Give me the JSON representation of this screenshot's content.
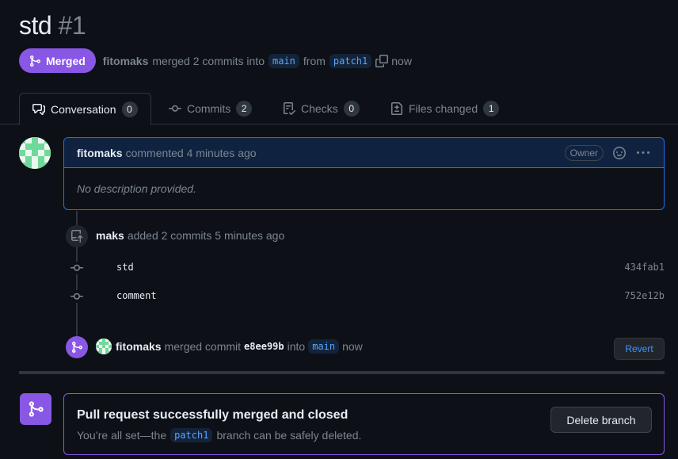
{
  "pr": {
    "title": "std",
    "number": "#1",
    "state_label": "Merged",
    "author": "fitomaks",
    "merge_summary": "merged 2 commits into",
    "base_branch": "main",
    "from_word": "from",
    "head_branch": "patch1",
    "time": "now"
  },
  "tabs": [
    {
      "label": "Conversation",
      "count": "0",
      "icon": "comment-discussion-icon"
    },
    {
      "label": "Commits",
      "count": "2",
      "icon": "git-commit-icon"
    },
    {
      "label": "Checks",
      "count": "0",
      "icon": "checklist-icon"
    },
    {
      "label": "Files changed",
      "count": "1",
      "icon": "file-diff-icon"
    }
  ],
  "comment": {
    "author": "fitomaks",
    "meta": "commented 4 minutes ago",
    "role_badge": "Owner",
    "body": "No description provided."
  },
  "commits_event": {
    "author": "maks",
    "text": "added 2 commits 5 minutes ago",
    "commits": [
      {
        "message": "std",
        "sha": "434fab1"
      },
      {
        "message": "comment",
        "sha": "752e12b"
      }
    ]
  },
  "merge_event": {
    "author": "fitomaks",
    "text": "merged commit",
    "sha": "e8ee99b",
    "into": "into",
    "branch": "main",
    "time": "now",
    "revert_label": "Revert"
  },
  "merge_box": {
    "heading": "Pull request successfully merged and closed",
    "sub_before": "You’re all set—the",
    "branch": "patch1",
    "sub_after": "branch can be safely deleted.",
    "delete_label": "Delete branch"
  },
  "colors": {
    "merged": "#8957e5",
    "accent": "#1f6feb",
    "link": "#58a6ff",
    "bg": "#0d1117"
  }
}
